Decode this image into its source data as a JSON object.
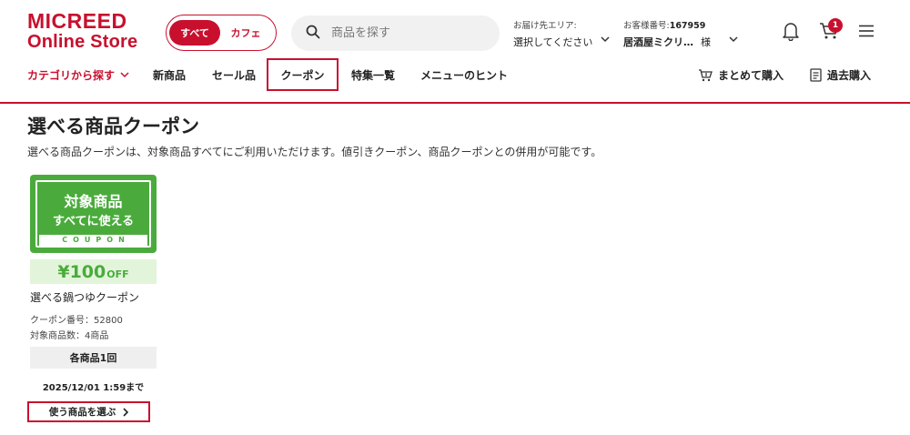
{
  "header": {
    "logo_line1": "MICREED",
    "logo_line2": "Online Store",
    "toggle": {
      "all": "すべて",
      "cafe": "カフェ"
    },
    "search_placeholder": "商品を探す",
    "area": {
      "label": "お届け先エリア:",
      "value": "選択してください"
    },
    "customer": {
      "label": "お客様番号:",
      "number": "167959",
      "name": "居酒屋ミクリ…",
      "suffix": "様"
    },
    "cart_count": "1",
    "icons": [
      "search-icon",
      "chevron-down-icon",
      "bell-icon",
      "cart-icon",
      "hamburger-menu-icon"
    ]
  },
  "nav": {
    "category": "カテゴリから探す",
    "new_items": "新商品",
    "sale": "セール品",
    "coupon": "クーポン",
    "features": "特集一覧",
    "menu_hint": "メニューのヒント",
    "bulk_buy": "まとめて購入",
    "past_buy": "過去購入"
  },
  "page": {
    "title": "選べる商品クーポン",
    "description": "選べる商品クーポンは、対象商品すべてにご利用いただけます。値引きクーポン、商品クーポンとの併用が可能です。"
  },
  "coupon": {
    "image_line1": "対象商品",
    "image_line2": "すべてに使える",
    "image_strip": "COUPON",
    "discount_amount": "¥100",
    "discount_off": "OFF",
    "name": "選べる鍋つゆクーポン",
    "number_label": "クーポン番号：52800",
    "items_label": "対象商品数：4商品",
    "limit": "各商品1回",
    "deadline": "2025/12/01 1:59まで",
    "choose_button": "使う商品を選ぶ"
  },
  "colors": {
    "brand_red": "#c8102e",
    "coupon_green": "#4aab3c",
    "coupon_light": "#e2f5da"
  }
}
